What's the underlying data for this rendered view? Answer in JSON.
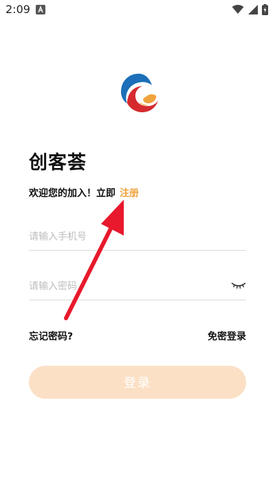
{
  "status_bar": {
    "time": "2:09",
    "icons": [
      "notification-a-icon",
      "wifi-icon",
      "signal-icon",
      "battery-charging-icon"
    ]
  },
  "app": {
    "title": "创客荟",
    "logo_colors": [
      "#1c6fb8",
      "#d52b2f",
      "#f0a33c"
    ]
  },
  "welcome": {
    "text": "欢迎您的加入！立即",
    "register_label": "注册"
  },
  "phone": {
    "placeholder": "请输入手机号",
    "value": ""
  },
  "password": {
    "placeholder": "请输入密码",
    "value": ""
  },
  "links": {
    "forgot_password": "忘记密码?",
    "sms_login": "免密登录"
  },
  "login_button": {
    "label": "登录"
  },
  "colors": {
    "accent": "#f0a33c",
    "button_bg": "#fbe0c6",
    "arrow": "#e8192c"
  }
}
